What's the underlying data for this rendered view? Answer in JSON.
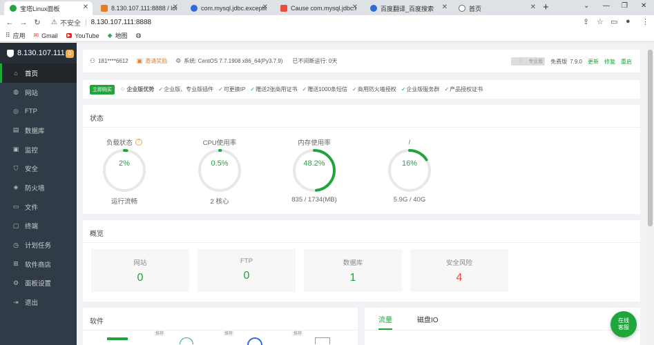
{
  "browser": {
    "tabs": [
      {
        "label": "宝塔Linux面板",
        "color": "#20a53a"
      },
      {
        "label": "8.130.107.111:8888 / loca",
        "color": "#e67e22"
      },
      {
        "label": "com.mysql.jdbc.exceptio",
        "color": "#2d6bd6"
      },
      {
        "label": "Cause com.mysql.jdbc.ex",
        "color": "#e74c3c"
      },
      {
        "label": "百度翻译_百度搜索",
        "color": "#2d6bd6"
      },
      {
        "label": "首页",
        "color": "#666666"
      }
    ],
    "insecure": "不安全",
    "url": "8.130.107.111:8888",
    "bookmarks": [
      "应用",
      "Gmail",
      "YouTube",
      "地图"
    ]
  },
  "sidebar": {
    "host": "8.130.107.111",
    "badge": "0",
    "items": [
      "首页",
      "网站",
      "FTP",
      "数据库",
      "监控",
      "安全",
      "防火墙",
      "文件",
      "终端",
      "计划任务",
      "软件商店",
      "面板设置",
      "退出"
    ]
  },
  "topinfo": {
    "user": "181****6612",
    "invite": "邀请奖励",
    "system": "系统: CentOS 7.7.1908 x86_64(Py3.7.9)",
    "uptime": "已不间断运行: 0天",
    "pro_label": "专业版",
    "edition": "免费版",
    "version": "7.9.0",
    "update": "更新",
    "repair": "修复",
    "restart": "重启"
  },
  "promo": {
    "buy": "立即购买",
    "title": "企业版优势",
    "features": [
      "企业版、专业版插件",
      "可更换IP",
      "赠送2张商用证书",
      "赠送1000条短信",
      "商用防火墙授权",
      "企业版服务群",
      "产品授权证书"
    ]
  },
  "status": {
    "title": "状态",
    "gauges": [
      {
        "label": "负载状态",
        "value": "2%",
        "percent": 2,
        "detail": "运行流畅",
        "help": "?"
      },
      {
        "label": "CPU使用率",
        "value": "0.5%",
        "percent": 0.5,
        "detail": "2 核心"
      },
      {
        "label": "内存使用率",
        "value": "48.2%",
        "percent": 48.2,
        "detail": "835 / 1734(MB)"
      },
      {
        "label": "/",
        "value": "16%",
        "percent": 16,
        "detail": "5.9G / 40G"
      }
    ]
  },
  "overview": {
    "title": "概览",
    "stats": [
      {
        "label": "网站",
        "value": "0"
      },
      {
        "label": "FTP",
        "value": "0"
      },
      {
        "label": "数据库",
        "value": "1"
      },
      {
        "label": "安全风险",
        "value": "4"
      }
    ]
  },
  "software": {
    "title": "软件",
    "recommend": "推荐"
  },
  "traffic": {
    "tabs": [
      "流量",
      "磁盘IO"
    ]
  },
  "float": {
    "line1": "在线",
    "line2": "客服"
  },
  "colors": {
    "accent": "#20a53a",
    "sidebar": "#2f3b47",
    "danger": "#e74c3c"
  }
}
